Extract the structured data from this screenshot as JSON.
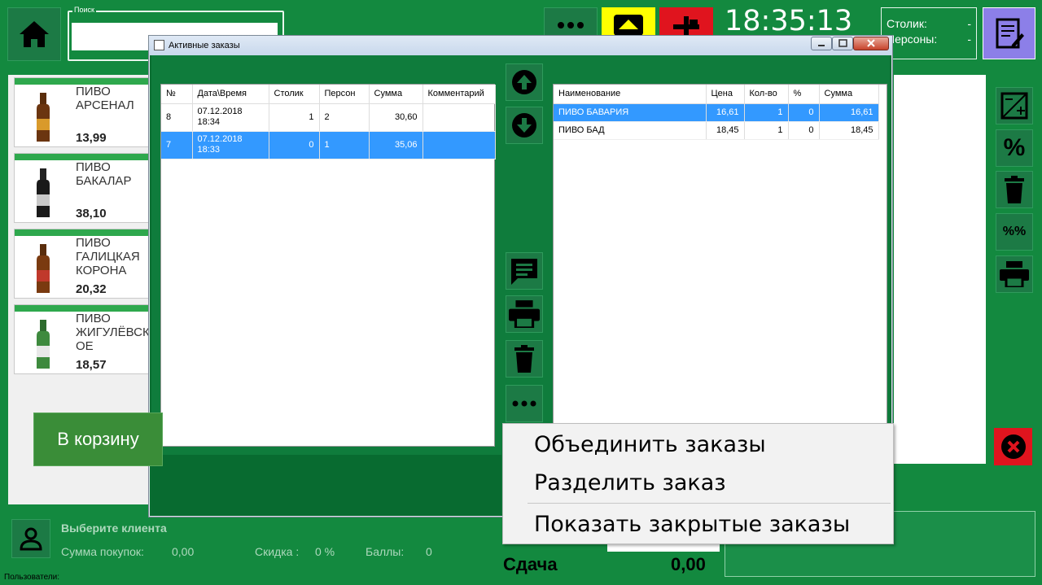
{
  "search": {
    "label": "Поиск",
    "value": ""
  },
  "clock": "18:35:13",
  "table_info": {
    "table_label": "Столик:",
    "table_value": "-",
    "persons_label": "Персоны:",
    "persons_value": "-"
  },
  "products": [
    {
      "name": "ПИВО АРСЕНАЛ",
      "price": "13,99"
    },
    {
      "name": "ПИВО БАКАЛАР",
      "price": "38,10"
    },
    {
      "name": "ПИВО ГАЛИЦКАЯ КОРОНА",
      "price": "20,32"
    },
    {
      "name": "ПИВО ЖИГУЛЁВСКОЕ",
      "price": "18,57"
    }
  ],
  "client": {
    "title": "Выберите клиента",
    "purchases_label": "Сумма покупок:",
    "purchases_value": "0,00",
    "discount_label": "Скидка :",
    "discount_value": "0 %",
    "points_label": "Баллы:",
    "points_value": "0"
  },
  "users_label": "Пользователи:",
  "change": {
    "label": "Сдача",
    "value": "0,00"
  },
  "dialog": {
    "title": "Активные заказы",
    "orders": {
      "headers": [
        "№",
        "Дата\\Время",
        "Столик",
        "Персон",
        "Сумма",
        "Комментарий"
      ],
      "rows": [
        {
          "num": "8",
          "date": "07.12.2018",
          "time": "18:34",
          "table": "1",
          "persons": "2",
          "sum": "30,60",
          "comment": "",
          "selected": false
        },
        {
          "num": "7",
          "date": "07.12.2018",
          "time": "18:33",
          "table": "0",
          "persons": "1",
          "sum": "35,06",
          "comment": "",
          "selected": true
        }
      ]
    },
    "items": {
      "headers": [
        "Наименование",
        "Цена",
        "Кол-во",
        "%",
        "Сумма"
      ],
      "rows": [
        {
          "name": "ПИВО БАВАРИЯ",
          "price": "16,61",
          "qty": "1",
          "pct": "0",
          "sum": "16,61",
          "selected": true
        },
        {
          "name": "ПИВО БАД",
          "price": "18,45",
          "qty": "1",
          "pct": "0",
          "sum": "18,45",
          "selected": false
        }
      ]
    },
    "to_cart": "В корзину"
  },
  "context_menu": [
    "Объединить заказы",
    "Разделить заказ",
    "Показать закрытые заказы"
  ],
  "colors": {
    "bg": "#13893f",
    "button": "#1c7a45",
    "selection": "#3399ff",
    "yellow": "#ffff00",
    "red": "#e0141e",
    "doc": "#8c7fe8"
  }
}
